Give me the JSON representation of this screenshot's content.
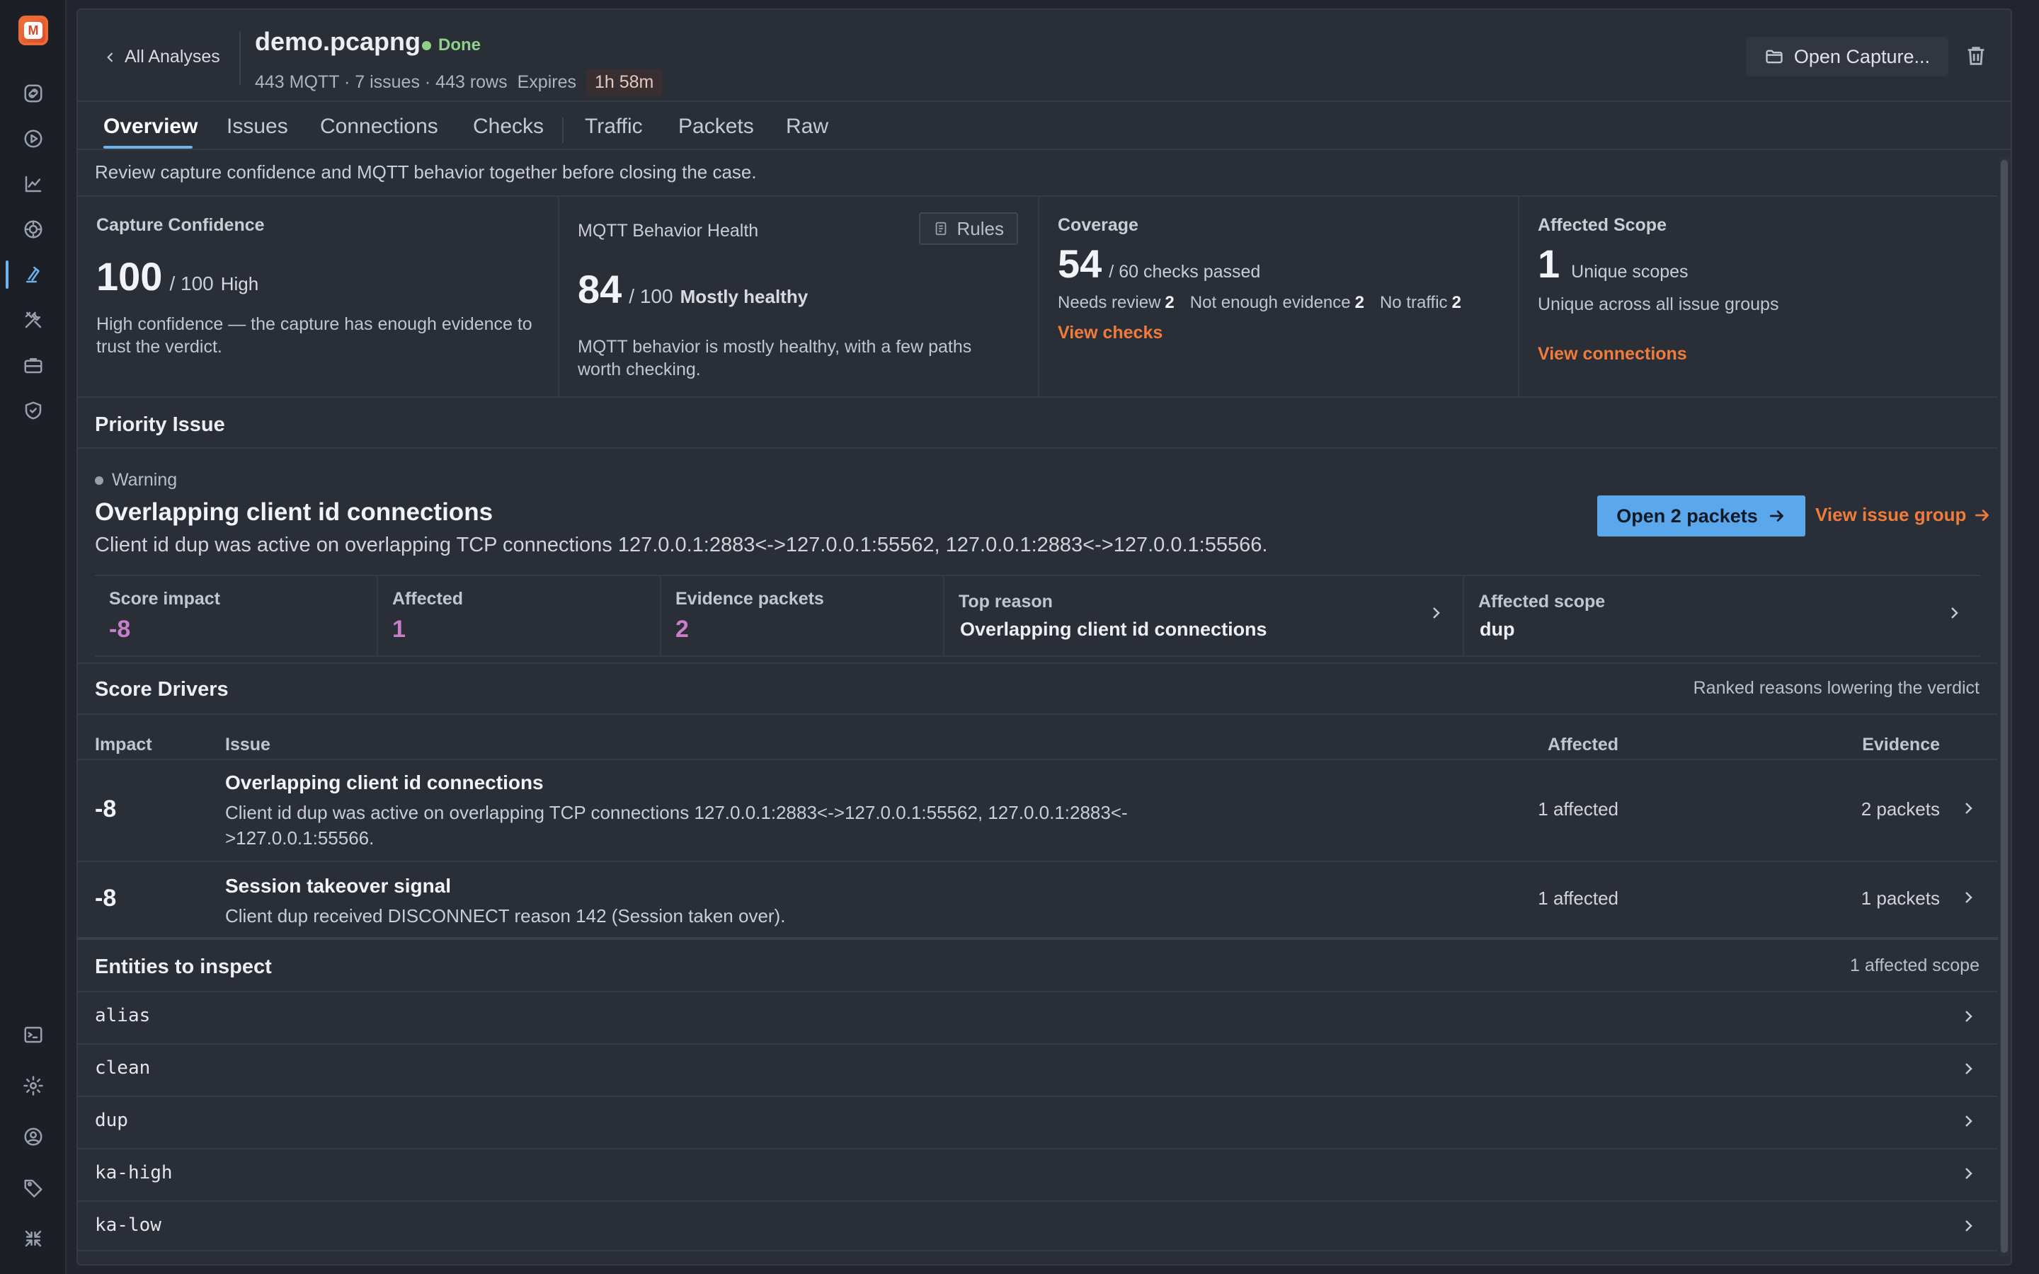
{
  "sidebar": {
    "logo_letter": "M",
    "top_icons": [
      "link-icon",
      "play-icon",
      "chart-icon",
      "target-icon",
      "flask-icon",
      "tools-icon",
      "briefcase-icon",
      "shield-icon"
    ],
    "bottom_icons": [
      "terminal-icon",
      "gear-icon",
      "user-icon",
      "tag-icon",
      "collapse-icon"
    ],
    "active_icon": "flask-icon"
  },
  "header": {
    "back_label": "All Analyses",
    "title": "demo.pcapng",
    "status": "Done",
    "summary": "443 MQTT · 7 issues · 443 rows",
    "expires_label": "Expires",
    "expires_value": "1h 58m",
    "open_capture_label": "Open Capture..."
  },
  "tabs": [
    "Overview",
    "Issues",
    "Connections",
    "Checks",
    "Traffic",
    "Packets",
    "Raw"
  ],
  "active_tab": "Overview",
  "intro": "Review capture confidence and MQTT behavior together before closing the case.",
  "cards": {
    "confidence": {
      "title": "Capture Confidence",
      "score": "100",
      "of": "/ 100",
      "quality": "High",
      "desc_line1": "High confidence — the capture has enough evidence to",
      "desc_line2": "trust the verdict."
    },
    "behavior": {
      "title": "MQTT Behavior Health",
      "rules_label": "Rules",
      "score": "84",
      "of": "/ 100",
      "quality": "Mostly healthy",
      "desc_line1": "MQTT behavior is mostly healthy, with a few paths",
      "desc_line2": "worth checking."
    },
    "coverage": {
      "title": "Coverage",
      "score": "54",
      "of": "/ 60 checks passed",
      "needs_review_label": "Needs review",
      "needs_review": "2",
      "not_enough_label": "Not enough evidence",
      "not_enough": "2",
      "no_traffic_label": "No traffic",
      "no_traffic": "2",
      "link": "View checks"
    },
    "scope": {
      "title": "Affected Scope",
      "score": "1",
      "of": "Unique scopes",
      "desc": "Unique across all issue groups",
      "link": "View connections"
    }
  },
  "priority": {
    "section_title": "Priority Issue",
    "severity": "Warning",
    "title": "Overlapping client id connections",
    "desc": "Client id dup was active on overlapping TCP connections 127.0.0.1:2883<->127.0.0.1:55562, 127.0.0.1:2883<->127.0.0.1:55566.",
    "open_packets_label": "Open 2 packets",
    "view_group_label": "View issue group",
    "metrics": {
      "score_impact_label": "Score impact",
      "score_impact": "-8",
      "affected_label": "Affected",
      "affected": "1",
      "evidence_label": "Evidence packets",
      "evidence": "2",
      "top_reason_label": "Top reason",
      "top_reason": "Overlapping client id connections",
      "scope_label": "Affected scope",
      "scope": "dup"
    }
  },
  "drivers": {
    "section_title": "Score Drivers",
    "subtitle": "Ranked reasons lowering the verdict",
    "columns": {
      "impact": "Impact",
      "issue": "Issue",
      "affected": "Affected",
      "evidence": "Evidence"
    },
    "rows": [
      {
        "impact": "-8",
        "title": "Overlapping client id connections",
        "desc_line1": "Client id dup was active on overlapping TCP connections 127.0.0.1:2883<->127.0.0.1:55562, 127.0.0.1:2883<-",
        "desc_line2": ">127.0.0.1:55566.",
        "affected": "1 affected",
        "evidence": "2 packets"
      },
      {
        "impact": "-8",
        "title": "Session takeover signal",
        "desc_line1": "Client dup received DISCONNECT reason 142 (Session taken over).",
        "affected": "1 affected",
        "evidence": "1 packets"
      }
    ]
  },
  "entities": {
    "section_title": "Entities to inspect",
    "subtitle": "1 affected scope",
    "items": [
      "alias",
      "clean",
      "dup",
      "ka-high",
      "ka-low"
    ]
  },
  "colors": {
    "accent": "#6cb4f0",
    "link": "#f07c3c",
    "metric": "#c77fc8",
    "done": "#8fd18a"
  }
}
